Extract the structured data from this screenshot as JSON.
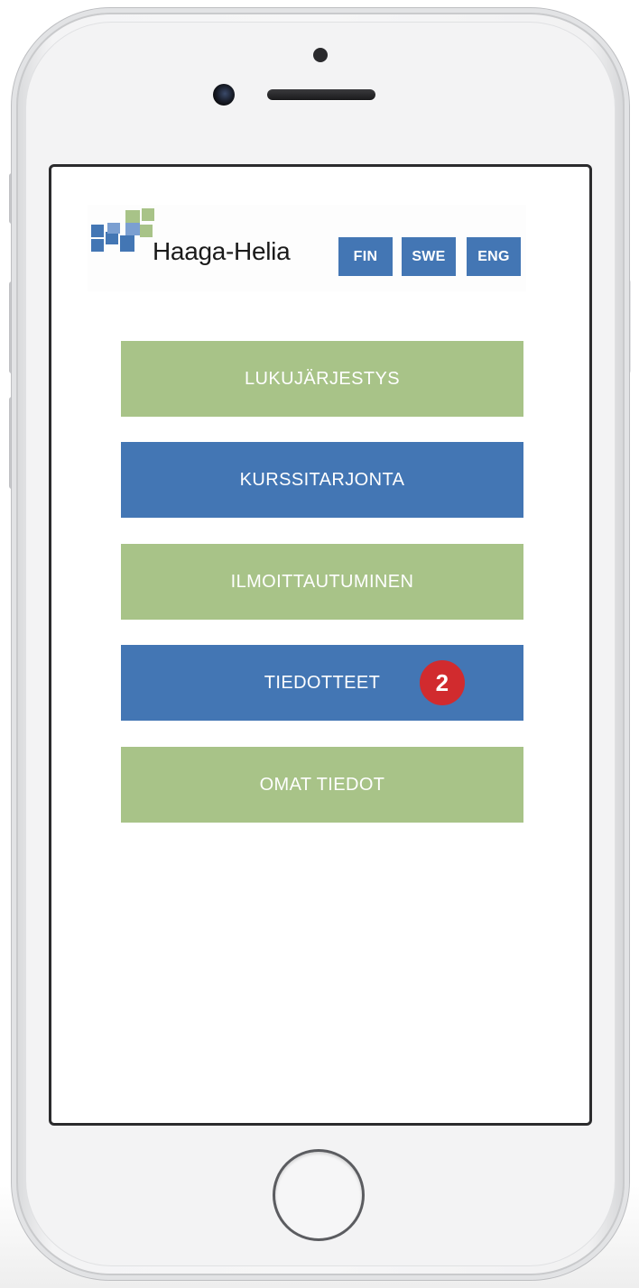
{
  "brand": {
    "name": "Haaga-Helia",
    "logo_icon": "haaga-helia-logo-mark",
    "colors": {
      "green": "#a8c388",
      "blue": "#4376b4",
      "badge_red": "#d12b2e"
    }
  },
  "languages": [
    {
      "label": "FIN"
    },
    {
      "label": "SWE"
    },
    {
      "label": "ENG"
    }
  ],
  "menu": [
    {
      "label": "LUKUJÄRJESTYS",
      "color": "green"
    },
    {
      "label": "KURSSITARJONTA",
      "color": "blue"
    },
    {
      "label": "ILMOITTAUTUMINEN",
      "color": "green"
    },
    {
      "label": "TIEDOTTEET",
      "color": "blue",
      "badge": "2"
    },
    {
      "label": "OMAT TIEDOT",
      "color": "green"
    }
  ]
}
